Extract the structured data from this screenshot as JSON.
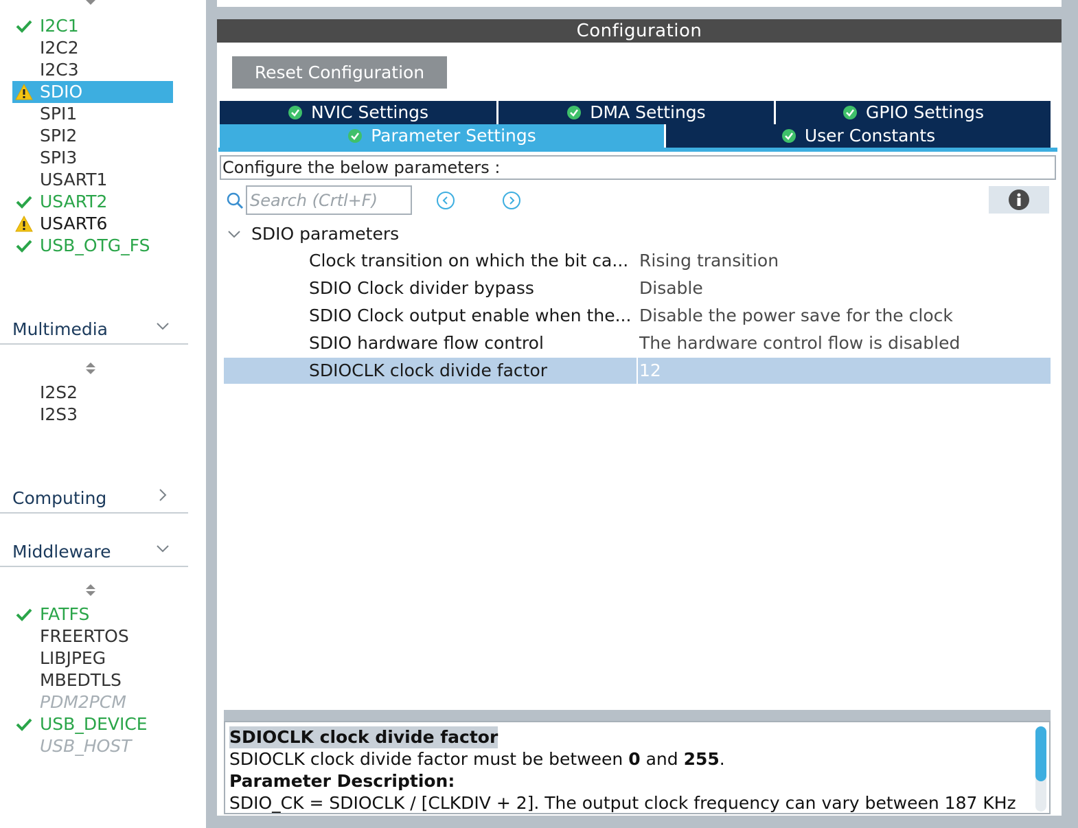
{
  "colors": {
    "accent": "#3daee0",
    "tab_dark": "#0a2a54",
    "ok_green": "#2aa549",
    "warning_yellow": "#f2c314",
    "header_gray": "#4b4b4b",
    "selected_row": "#b8d0e8"
  },
  "sidebar": {
    "connectivity_items": [
      {
        "label": "I2C1",
        "status": "ok",
        "icon": "check-icon"
      },
      {
        "label": "I2C2",
        "status": "normal"
      },
      {
        "label": "I2C3",
        "status": "normal"
      },
      {
        "label": "SDIO",
        "status": "warning",
        "icon": "warning-icon",
        "selected": true
      },
      {
        "label": "SPI1",
        "status": "normal"
      },
      {
        "label": "SPI2",
        "status": "normal"
      },
      {
        "label": "SPI3",
        "status": "normal"
      },
      {
        "label": "USART1",
        "status": "normal"
      },
      {
        "label": "USART2",
        "status": "ok",
        "icon": "check-icon"
      },
      {
        "label": "USART6",
        "status": "warning",
        "icon": "warning-icon"
      },
      {
        "label": "USB_OTG_FS",
        "status": "ok",
        "icon": "check-icon"
      }
    ],
    "categories": {
      "multimedia": {
        "label": "Multimedia",
        "expanded": true,
        "items": [
          {
            "label": "I2S2",
            "status": "normal"
          },
          {
            "label": "I2S3",
            "status": "normal"
          }
        ]
      },
      "computing": {
        "label": "Computing",
        "expanded": false
      },
      "middleware": {
        "label": "Middleware",
        "expanded": true,
        "items": [
          {
            "label": "FATFS",
            "status": "ok",
            "icon": "check-icon"
          },
          {
            "label": "FREERTOS",
            "status": "normal"
          },
          {
            "label": "LIBJPEG",
            "status": "normal"
          },
          {
            "label": "MBEDTLS",
            "status": "normal"
          },
          {
            "label": "PDM2PCM",
            "status": "disabled"
          },
          {
            "label": "USB_DEVICE",
            "status": "ok",
            "icon": "check-icon"
          },
          {
            "label": "USB_HOST",
            "status": "disabled"
          }
        ]
      }
    }
  },
  "configuration": {
    "title": "Configuration",
    "reset_label": "Reset Configuration",
    "tabs_row1": [
      "NVIC Settings",
      "DMA Settings",
      "GPIO Settings"
    ],
    "tabs_row2": [
      "Parameter Settings",
      "User Constants"
    ],
    "active_tab": "Parameter Settings",
    "configure_label": "Configure the below parameters :",
    "search_placeholder": "Search (Crtl+F)",
    "group_label": "SDIO parameters",
    "parameters": [
      {
        "name": "Clock transition on which the bit ca...",
        "value": "Rising transition"
      },
      {
        "name": "SDIO Clock divider bypass",
        "value": "Disable"
      },
      {
        "name": "SDIO Clock output enable when the...",
        "value": "Disable the power save for the clock"
      },
      {
        "name": "SDIO hardware flow control",
        "value": "The hardware control flow is disabled"
      },
      {
        "name": "SDIOCLK clock divide factor",
        "value": "12",
        "selected": true
      }
    ]
  },
  "description": {
    "title": "SDIOCLK clock divide factor",
    "range_prefix": "SDIOCLK clock divide factor must be between ",
    "range_min": "0",
    "range_mid": " and ",
    "range_max": "255",
    "range_suffix": ".",
    "param_desc_heading": "Parameter Description:",
    "param_desc_text": "SDIO_CK = SDIOCLK / [CLKDIV + 2]. The output clock frequency can vary between 187 KHz"
  }
}
